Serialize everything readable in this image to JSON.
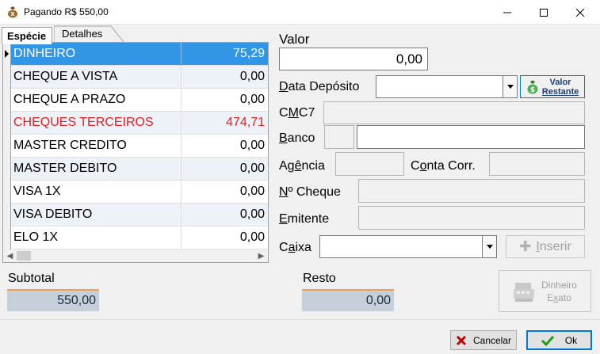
{
  "window": {
    "title": "Pagando R$ 550,00",
    "minimize_glyph": "—",
    "maximize_glyph": "☐",
    "close_glyph": "✕",
    "app_icon": "money-bag-icon"
  },
  "tabs": [
    {
      "label": "Espécie",
      "active": true
    },
    {
      "label": "Detalhes",
      "active": false
    }
  ],
  "payment_types": [
    {
      "name": "DINHEIRO",
      "value": "75,29",
      "selected": true,
      "color": "#ffffff"
    },
    {
      "name": "CHEQUE A VISTA",
      "value": "0,00"
    },
    {
      "name": "CHEQUE A PRAZO",
      "value": "0,00"
    },
    {
      "name": "CHEQUES TERCEIROS",
      "value": "474,71",
      "color": "#e82020"
    },
    {
      "name": "MASTER CREDITO",
      "value": "0,00"
    },
    {
      "name": "MASTER DEBITO",
      "value": "0,00"
    },
    {
      "name": "VISA 1X",
      "value": "0,00"
    },
    {
      "name": "VISA DEBITO",
      "value": "0,00"
    },
    {
      "name": "ELO 1X",
      "value": "0,00"
    }
  ],
  "form": {
    "valor_label": "Valor",
    "valor_value": "0,00",
    "data_deposito_label_pre": "D",
    "data_deposito_label_post": "ata Depósito",
    "data_deposito_value": "",
    "valor_restante_line1": "Valor",
    "valor_restante_line2": "Restante",
    "cmc7_label_pre": "C",
    "cmc7_label_u": "M",
    "cmc7_label_post": "C7",
    "banco_label_pre": "B",
    "banco_label_post": "anco",
    "agencia_label_pre": "Ag",
    "agencia_label_u": "ê",
    "agencia_label_post": "ncia",
    "conta_label_pre": "C",
    "conta_label_u": "o",
    "conta_label_post": "nta Corr.",
    "cheque_label_pre": "N",
    "cheque_label_post": "º Cheque",
    "emitente_label_pre": "E",
    "emitente_label_post": "mitente",
    "caixa_label_pre": "C",
    "caixa_label_u": "a",
    "caixa_label_post": "ixa",
    "caixa_value": "",
    "inserir_label_pre": "",
    "inserir_label_u": "I",
    "inserir_label_post": "nserir"
  },
  "summary": {
    "subtotal_label": "Subtotal",
    "subtotal_value": "550,00",
    "resto_label": "Resto",
    "resto_value": "0,00",
    "dinheiro_exato_line1": "Dinheiro",
    "dinheiro_exato_line2_pre": "E",
    "dinheiro_exato_line2_u": "x",
    "dinheiro_exato_line2_post": "ato"
  },
  "footer": {
    "cancelar_label": "Cancelar",
    "ok_label": "Ok"
  },
  "colors": {
    "selection": "#3296e6",
    "summary_box": "#c5cfda",
    "summary_accent": "#f0a055",
    "ok_border": "#0078d7"
  }
}
